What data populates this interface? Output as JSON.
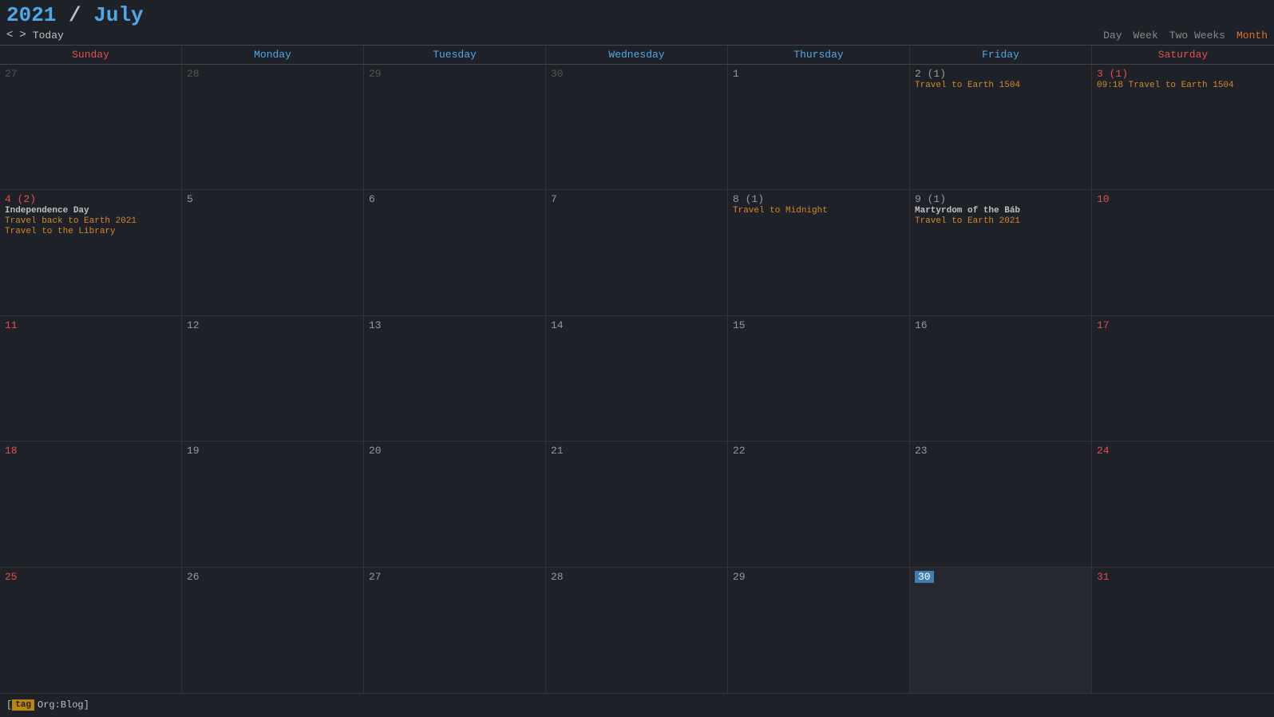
{
  "header": {
    "year": "2021",
    "slash": " / ",
    "month": "July",
    "title_full": "2021 / July"
  },
  "nav": {
    "prev": "<",
    "next": ">",
    "today": "Today"
  },
  "views": {
    "day": "Day",
    "week": "Week",
    "two_weeks": "Two Weeks",
    "month": "Month"
  },
  "day_headers": [
    {
      "label": "Sunday",
      "type": "weekend"
    },
    {
      "label": "Monday",
      "type": "weekday"
    },
    {
      "label": "Tuesday",
      "type": "weekday"
    },
    {
      "label": "Wednesday",
      "type": "weekday"
    },
    {
      "label": "Thursday",
      "type": "weekday"
    },
    {
      "label": "Friday",
      "type": "weekday"
    },
    {
      "label": "Saturday",
      "type": "weekend"
    }
  ],
  "weeks": [
    [
      {
        "day": 27,
        "other": true,
        "events": []
      },
      {
        "day": 28,
        "other": true,
        "events": []
      },
      {
        "day": 29,
        "other": true,
        "events": []
      },
      {
        "day": 30,
        "other": true,
        "events": []
      },
      {
        "day": 1,
        "events": []
      },
      {
        "day": 2,
        "count": 1,
        "events": [
          {
            "text": "Travel to Earth 1504",
            "type": "travel"
          }
        ]
      },
      {
        "day": 3,
        "weekend": true,
        "count": 1,
        "events": [
          {
            "text": "09:18 Travel to Earth 1504",
            "type": "travel"
          }
        ]
      }
    ],
    [
      {
        "day": 4,
        "weekend": true,
        "count": 2,
        "events": [
          {
            "text": "Independence Day",
            "type": "holiday"
          },
          {
            "text": "Travel back to Earth 2021",
            "type": "travel"
          },
          {
            "text": "Travel to the Library",
            "type": "travel"
          }
        ]
      },
      {
        "day": 5,
        "events": []
      },
      {
        "day": 6,
        "events": []
      },
      {
        "day": 7,
        "events": []
      },
      {
        "day": 8,
        "count": 1,
        "events": [
          {
            "text": "Travel to Midnight",
            "type": "midnight"
          }
        ]
      },
      {
        "day": 9,
        "count": 1,
        "events": [
          {
            "text": "Martyrdom of the Báb",
            "type": "martyrdom"
          },
          {
            "text": "Travel to Earth 2021",
            "type": "travel"
          }
        ]
      },
      {
        "day": 10,
        "weekend": true,
        "events": []
      }
    ],
    [
      {
        "day": 11,
        "weekend": true,
        "events": []
      },
      {
        "day": 12,
        "events": []
      },
      {
        "day": 13,
        "events": []
      },
      {
        "day": 14,
        "events": []
      },
      {
        "day": 15,
        "events": []
      },
      {
        "day": 16,
        "events": []
      },
      {
        "day": 17,
        "weekend": true,
        "events": []
      }
    ],
    [
      {
        "day": 18,
        "weekend": true,
        "events": []
      },
      {
        "day": 19,
        "events": []
      },
      {
        "day": 20,
        "events": []
      },
      {
        "day": 21,
        "events": []
      },
      {
        "day": 22,
        "events": []
      },
      {
        "day": 23,
        "events": []
      },
      {
        "day": 24,
        "weekend": true,
        "events": []
      }
    ],
    [
      {
        "day": 25,
        "weekend": true,
        "events": []
      },
      {
        "day": 26,
        "events": []
      },
      {
        "day": 27,
        "events": []
      },
      {
        "day": 28,
        "events": []
      },
      {
        "day": 29,
        "events": []
      },
      {
        "day": 30,
        "today": true,
        "events": []
      },
      {
        "day": 31,
        "weekend": true,
        "events": []
      }
    ]
  ],
  "bottom_bar": {
    "tag": "tag",
    "text": "Org:Blog]"
  }
}
